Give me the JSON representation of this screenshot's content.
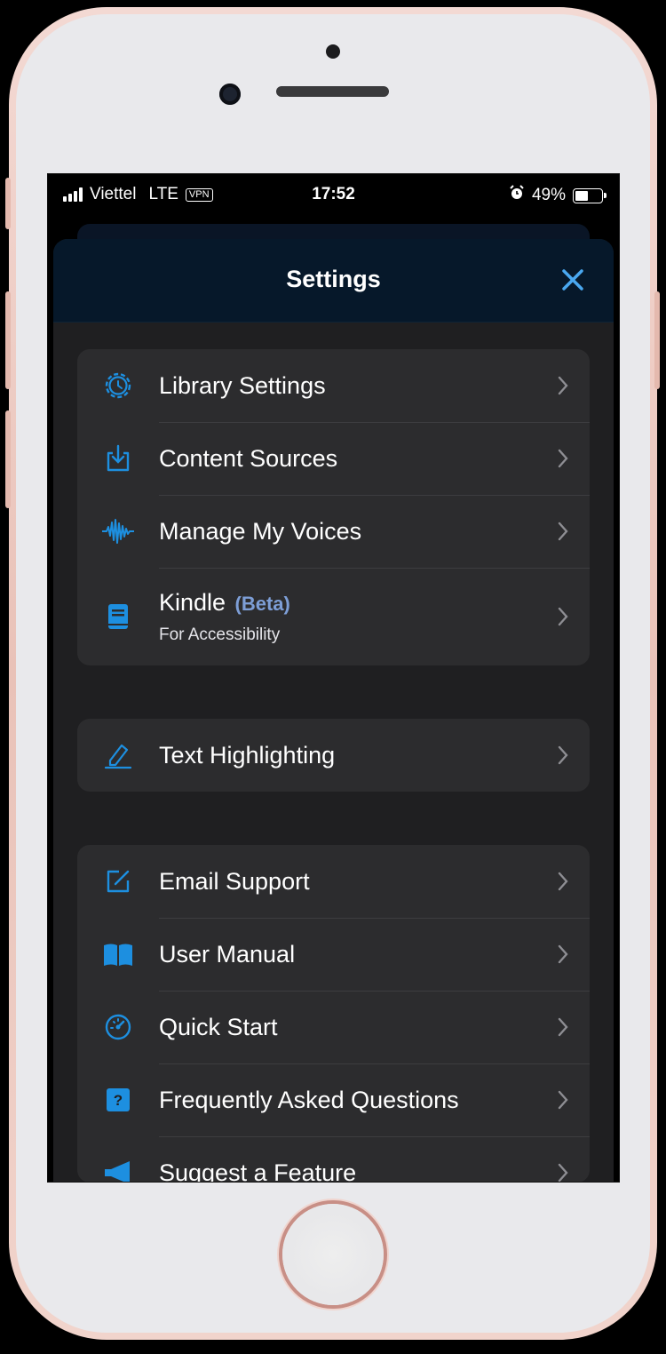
{
  "status_bar": {
    "carrier": "Viettel",
    "network": "LTE",
    "vpn": "VPN",
    "time": "17:52",
    "battery": "49%"
  },
  "header": {
    "title": "Settings",
    "close_icon": "close-icon"
  },
  "groups": {
    "library": [
      {
        "icon": "gear-icon",
        "label": "Library Settings"
      },
      {
        "icon": "download-tray-icon",
        "label": "Content Sources"
      },
      {
        "icon": "voice-waveform-icon",
        "label": "Manage My Voices"
      },
      {
        "icon": "book-icon",
        "label": "Kindle",
        "badge": "(Beta)",
        "sublabel": "For Accessibility"
      }
    ],
    "highlight": [
      {
        "icon": "pencil-icon",
        "label": "Text Highlighting"
      }
    ],
    "support": [
      {
        "icon": "compose-icon",
        "label": "Email Support"
      },
      {
        "icon": "open-book-icon",
        "label": "User Manual"
      },
      {
        "icon": "speedometer-icon",
        "label": "Quick Start"
      },
      {
        "icon": "question-mark-icon",
        "label": "Frequently Asked Questions"
      },
      {
        "icon": "megaphone-icon",
        "label": "Suggest a Feature"
      }
    ]
  },
  "colors": {
    "accent": "#1d8fe0",
    "header_bg": "#06182a",
    "sheet_bg": "#1f1f21",
    "row_bg": "#2c2c2e",
    "beta": "#7d9ed6"
  }
}
